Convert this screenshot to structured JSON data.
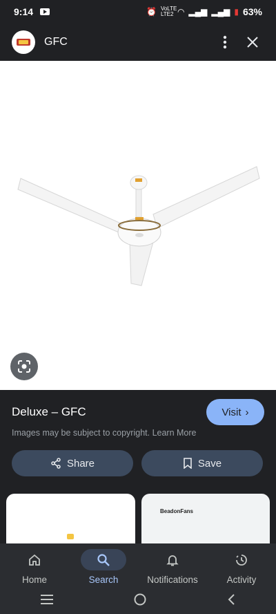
{
  "status_bar": {
    "time": "9:14",
    "network_label": "VoLTE LTE2",
    "battery": "63%"
  },
  "header": {
    "title": "GFC"
  },
  "result": {
    "title": "Deluxe – GFC",
    "visit_label": "Visit",
    "copyright": "Images may be subject to copyright. Learn More",
    "share_label": "Share",
    "save_label": "Save"
  },
  "related": {
    "card2_brand": "BeadonFans"
  },
  "bottom_nav": [
    {
      "label": "Home",
      "icon": "home-icon",
      "active": false
    },
    {
      "label": "Search",
      "icon": "search-icon",
      "active": true
    },
    {
      "label": "Notifications",
      "icon": "bell-icon",
      "active": false
    },
    {
      "label": "Activity",
      "icon": "activity-icon",
      "active": false
    }
  ],
  "colors": {
    "accent": "#8ab4f8",
    "button_bg": "#3c4a5e",
    "background": "#202124"
  }
}
